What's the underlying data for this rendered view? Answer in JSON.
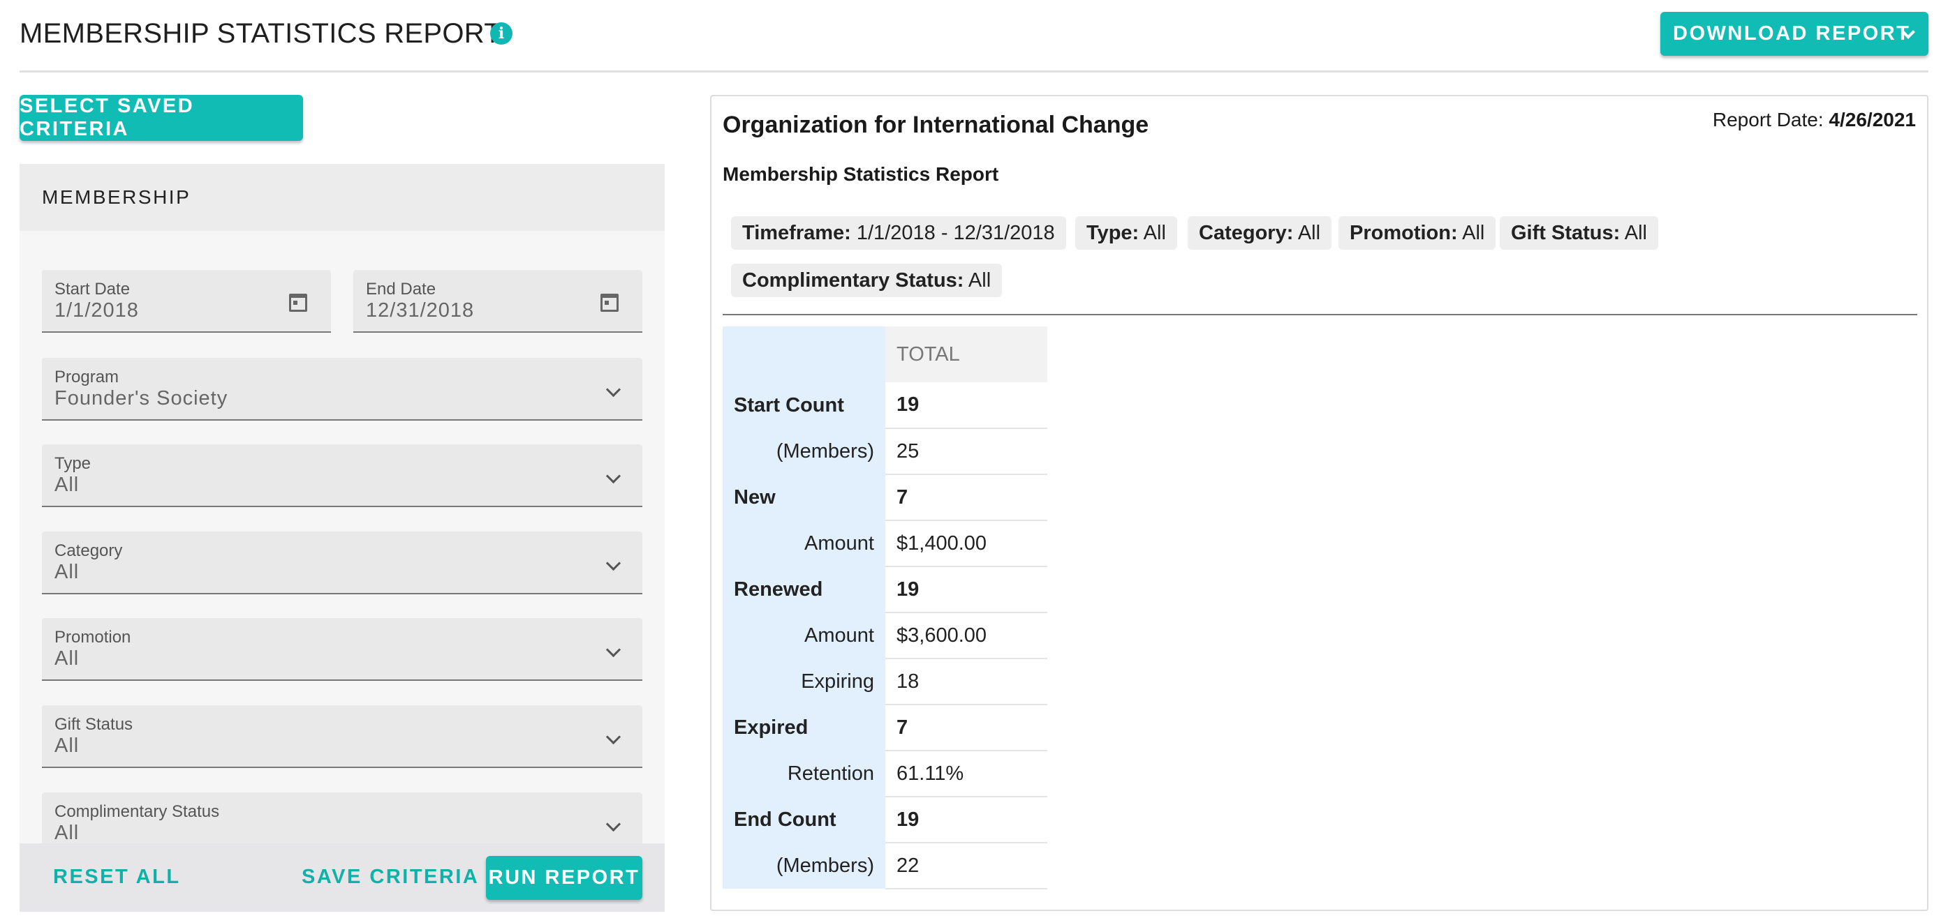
{
  "header": {
    "title": "MEMBERSHIP STATISTICS REPORT",
    "info_icon": "i",
    "download_label": "DOWNLOAD REPORT"
  },
  "left_panel": {
    "saved_criteria_label": "SELECT SAVED CRITERIA",
    "section_title": "MEMBERSHIP",
    "fields": {
      "start_date": {
        "label": "Start Date",
        "value": "1/1/2018"
      },
      "end_date": {
        "label": "End Date",
        "value": "12/31/2018"
      },
      "program": {
        "label": "Program",
        "value": "Founder's Society"
      },
      "type": {
        "label": "Type",
        "value": "All"
      },
      "category": {
        "label": "Category",
        "value": "All"
      },
      "promotion": {
        "label": "Promotion",
        "value": "All"
      },
      "gift_status": {
        "label": "Gift Status",
        "value": "All"
      },
      "complimentary_status": {
        "label": "Complimentary Status",
        "value": "All"
      }
    },
    "footer": {
      "reset_label": "RESET ALL",
      "save_label": "SAVE CRITERIA",
      "run_label": "RUN REPORT"
    }
  },
  "report": {
    "org_name": "Organization for International Change",
    "date_label": "Report Date:",
    "date_value": "4/26/2021",
    "subtitle": "Membership Statistics Report",
    "filters": [
      {
        "key": "Timeframe:",
        "value": "1/1/2018 - 12/31/2018"
      },
      {
        "key": "Type:",
        "value": "All"
      },
      {
        "key": "Category:",
        "value": "All"
      },
      {
        "key": "Promotion:",
        "value": "All"
      },
      {
        "key": "Gift Status:",
        "value": "All"
      },
      {
        "key": "Complimentary Status:",
        "value": "All"
      }
    ],
    "table": {
      "column_header": "TOTAL",
      "rows": [
        {
          "label": "Start Count",
          "value": "19"
        },
        {
          "label": "(Members)",
          "value": "25"
        },
        {
          "label": "New",
          "value": "7"
        },
        {
          "label": "Amount",
          "value": "$1,400.00"
        },
        {
          "label": "Renewed",
          "value": "19"
        },
        {
          "label": "Amount",
          "value": "$3,600.00"
        },
        {
          "label": "Expiring",
          "value": "18"
        },
        {
          "label": "Expired",
          "value": "7"
        },
        {
          "label": "Retention",
          "value": "61.11%"
        },
        {
          "label": "End Count",
          "value": "19"
        },
        {
          "label": "(Members)",
          "value": "22"
        }
      ]
    }
  },
  "colors": {
    "accent": "#11bcb5",
    "row_label_bg": "#e2effc"
  }
}
